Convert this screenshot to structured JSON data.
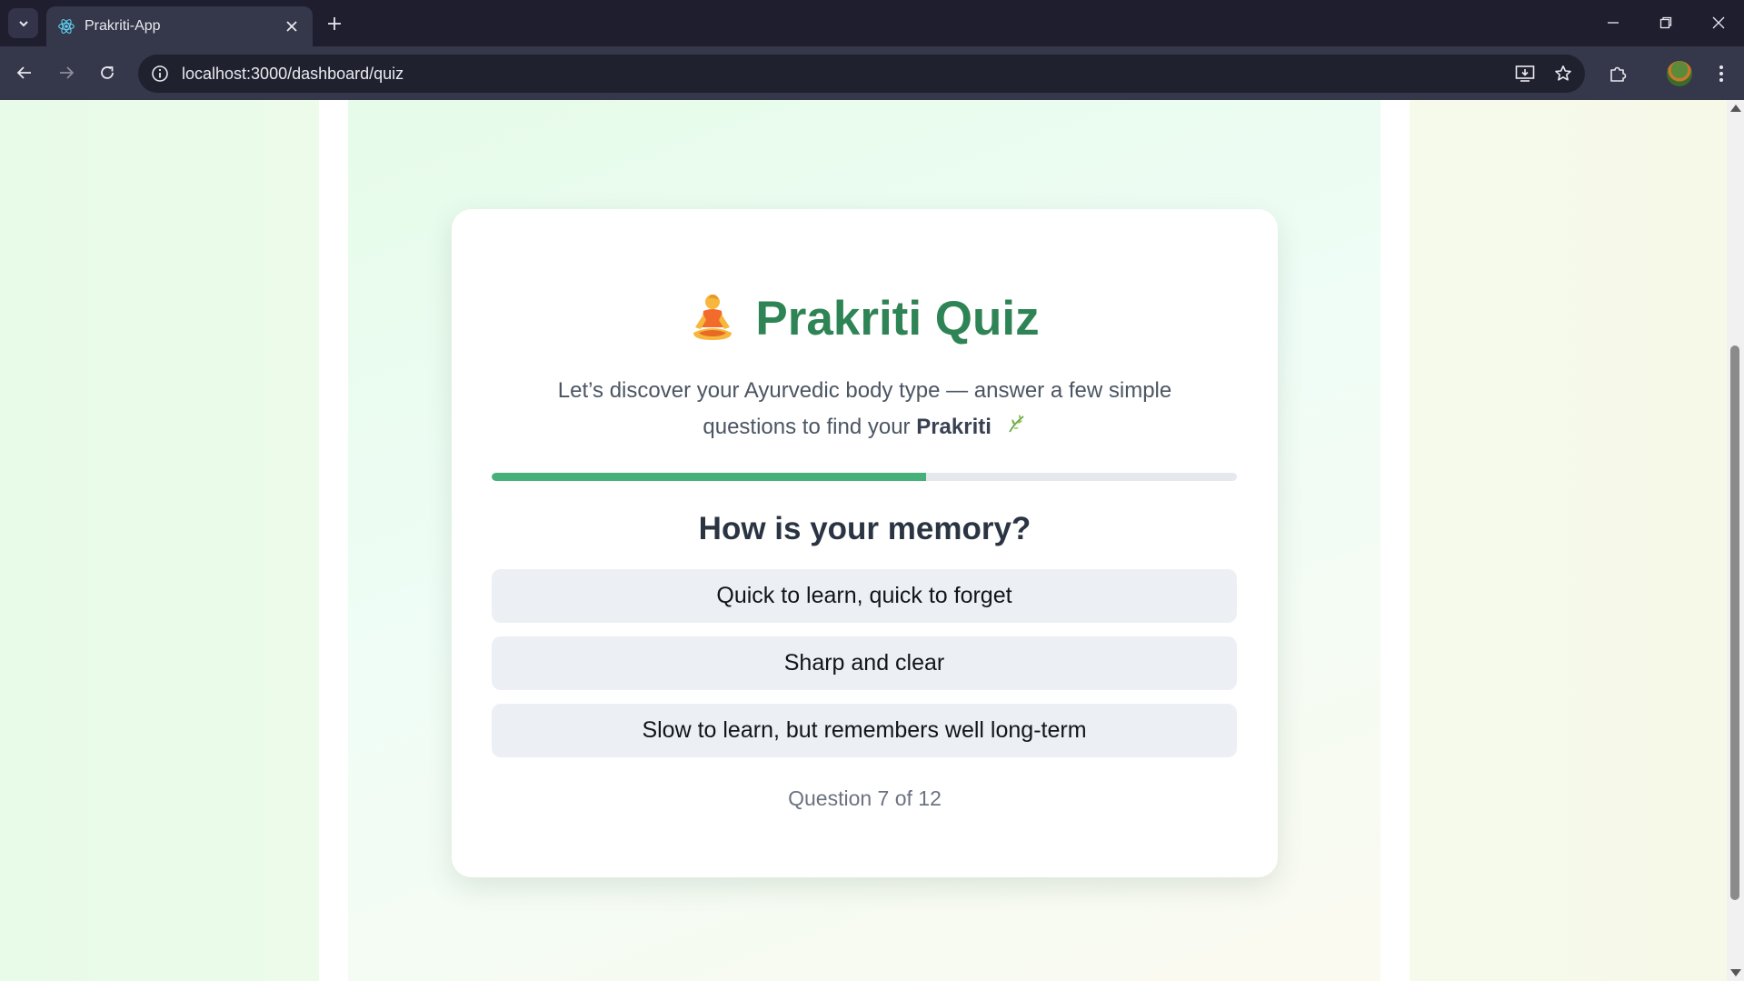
{
  "browser": {
    "tab_title": "Prakriti-App",
    "url": "localhost:3000/dashboard/quiz",
    "icons": {
      "tab_menu": "chevron-down-icon",
      "favicon": "react-logo-icon",
      "close": "close-icon",
      "new_tab": "plus-icon",
      "back": "back-arrow-icon",
      "forward": "forward-arrow-icon",
      "reload": "reload-icon",
      "site_info": "info-icon",
      "install": "install-app-icon",
      "bookmark": "star-icon",
      "extensions": "puzzle-icon",
      "menu": "kebab-menu-icon"
    }
  },
  "quiz": {
    "title": "Prakriti Quiz",
    "title_emoji": "meditating-person-icon",
    "subtitle_prefix": "Let’s discover your Ayurvedic body type — answer a few simple questions to find your ",
    "subtitle_bold": "Prakriti",
    "subtitle_emoji": "herb-leaf-icon",
    "progress_fraction": 0.583,
    "question": "How is your memory?",
    "options": [
      "Quick to learn, quick to forget",
      "Sharp and clear",
      "Slow to learn, but remembers well long-term"
    ],
    "counter": "Question 7 of 12"
  },
  "colors": {
    "title_green": "#2e8455",
    "progress_fill": "#47b07a",
    "progress_track": "#e5e9ee",
    "option_bg": "#ecf0f4",
    "question_text": "#2a3442"
  }
}
